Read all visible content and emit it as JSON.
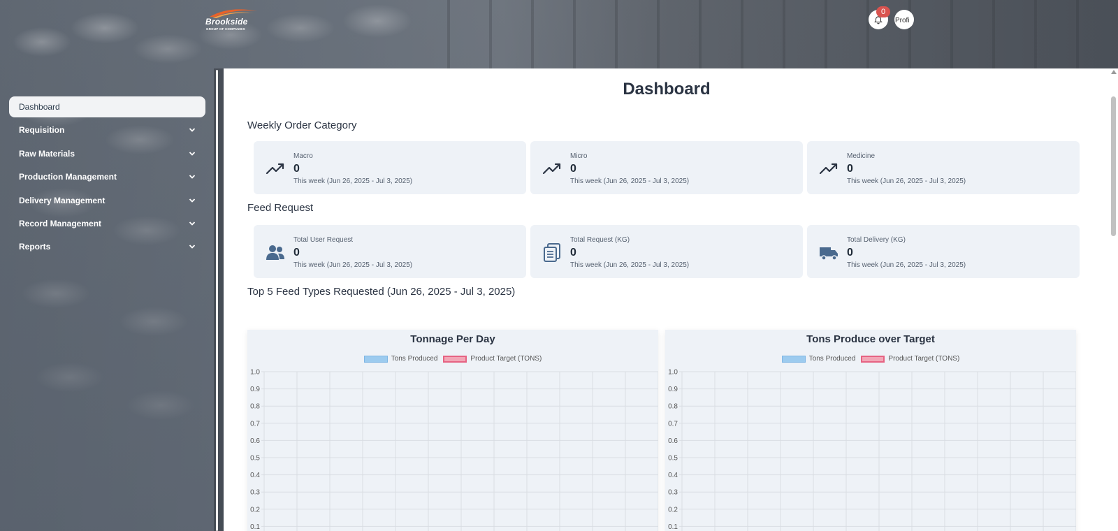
{
  "brand": {
    "name": "Brookside",
    "tagline": "GROUP OF COMPANIES"
  },
  "header": {
    "notification_count": "0",
    "avatar_alt": "Profi"
  },
  "sidebar": {
    "items": [
      {
        "label": "Dashboard",
        "active": true
      },
      {
        "label": "Requisition"
      },
      {
        "label": "Raw Materials"
      },
      {
        "label": "Production Management"
      },
      {
        "label": "Delivery Management"
      },
      {
        "label": "Record Management"
      },
      {
        "label": "Reports"
      }
    ]
  },
  "main": {
    "title": "Dashboard",
    "weekly_order": {
      "heading": "Weekly Order Category",
      "cards": [
        {
          "label": "Macro",
          "value": "0",
          "sub": "This week (Jun 26, 2025 - Jul 3, 2025)",
          "icon": "trending-up-icon"
        },
        {
          "label": "Micro",
          "value": "0",
          "sub": "This week (Jun 26, 2025 - Jul 3, 2025)",
          "icon": "trending-up-icon"
        },
        {
          "label": "Medicine",
          "value": "0",
          "sub": "This week (Jun 26, 2025 - Jul 3, 2025)",
          "icon": "trending-up-icon"
        }
      ]
    },
    "feed_request": {
      "heading": "Feed Request",
      "cards": [
        {
          "label": "Total User Request",
          "value": "0",
          "sub": "This week (Jun 26, 2025 - Jul 3, 2025)",
          "icon": "users-icon"
        },
        {
          "label": "Total Request (KG)",
          "value": "0",
          "sub": "This week (Jun 26, 2025 - Jul 3, 2025)",
          "icon": "clipboard-icon"
        },
        {
          "label": "Total Delivery (KG)",
          "value": "0",
          "sub": "This week (Jun 26, 2025 - Jul 3, 2025)",
          "icon": "truck-icon"
        }
      ]
    },
    "top_feed_heading": "Top 5 Feed Types Requested (Jun 26, 2025 - Jul 3, 2025)"
  },
  "colors": {
    "accent": "#2b3443",
    "card_bg": "#eef2f7",
    "tons_produced": "#9ccbef",
    "product_target": "#f2a6b6",
    "badge": "#d9534f"
  },
  "chart_data": [
    {
      "type": "bar",
      "title": "Tonnage Per Day",
      "series": [
        {
          "name": "Tons Produced",
          "values": []
        },
        {
          "name": "Product Target (TONS)",
          "values": []
        }
      ],
      "categories": [],
      "ylim": [
        0,
        1.0
      ],
      "yticks": [
        "1.0",
        "0.9",
        "0.8",
        "0.7",
        "0.6",
        "0.5",
        "0.4",
        "0.3",
        "0.2",
        "0.1"
      ],
      "grid": true,
      "legend": "top"
    },
    {
      "type": "bar",
      "title": "Tons Produce over Target",
      "series": [
        {
          "name": "Tons Produced",
          "values": []
        },
        {
          "name": "Product Target (TONS)",
          "values": []
        }
      ],
      "categories": [],
      "ylim": [
        0,
        1.0
      ],
      "yticks": [
        "1.0",
        "0.9",
        "0.8",
        "0.7",
        "0.6",
        "0.5",
        "0.4",
        "0.3",
        "0.2",
        "0.1"
      ],
      "grid": true,
      "legend": "top"
    }
  ]
}
